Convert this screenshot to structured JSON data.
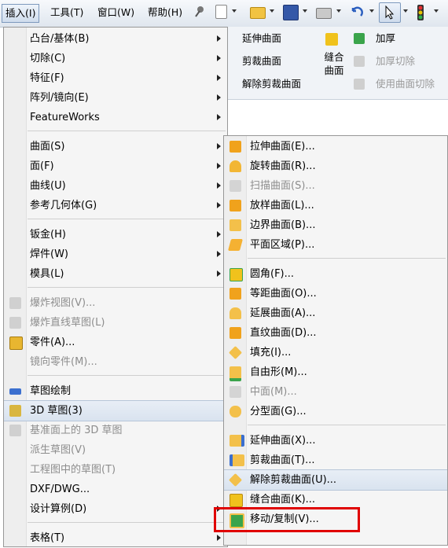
{
  "menubar": {
    "items": [
      "插入(I)",
      "工具(T)",
      "窗口(W)",
      "帮助(H)"
    ]
  },
  "ribbon": {
    "surface_items": [
      "延伸曲面",
      "剪裁曲面",
      "解除剪裁曲面"
    ],
    "knit": "缝合曲面",
    "thicken": [
      "加厚",
      "加厚切除",
      "使用曲面切除"
    ]
  },
  "insert_menu": {
    "items": [
      {
        "label": "凸台/基体(B)"
      },
      {
        "label": "切除(C)"
      },
      {
        "label": "特征(F)"
      },
      {
        "label": "阵列/镜向(E)"
      },
      {
        "label": "FeatureWorks"
      },
      {
        "label": "曲面(S)"
      },
      {
        "label": "面(F)"
      },
      {
        "label": "曲线(U)"
      },
      {
        "label": "参考几何体(G)"
      },
      {
        "label": "钣金(H)"
      },
      {
        "label": "焊件(W)"
      },
      {
        "label": "模具(L)"
      },
      {
        "label": "爆炸视图(V)..."
      },
      {
        "label": "爆炸直线草图(L)"
      },
      {
        "label": "零件(A)..."
      },
      {
        "label": "镜向零件(M)..."
      },
      {
        "label": "草图绘制"
      },
      {
        "label": "3D 草图(3)"
      },
      {
        "label": "基准面上的 3D 草图"
      },
      {
        "label": "派生草图(V)"
      },
      {
        "label": "工程图中的草图(T)"
      },
      {
        "label": "DXF/DWG..."
      },
      {
        "label": "设计算例(D)"
      },
      {
        "label": "表格(T)"
      }
    ]
  },
  "surface_submenu": {
    "items": [
      {
        "label": "拉伸曲面(E)...",
        "icon": "extruded-surface-icon"
      },
      {
        "label": "旋转曲面(R)...",
        "icon": "revolved-surface-icon"
      },
      {
        "label": "扫描曲面(S)...",
        "icon": "swept-surface-icon"
      },
      {
        "label": "放样曲面(L)...",
        "icon": "lofted-surface-icon"
      },
      {
        "label": "边界曲面(B)...",
        "icon": "boundary-surface-icon"
      },
      {
        "label": "平面区域(P)...",
        "icon": "planar-surface-icon"
      },
      {
        "label": "圆角(F)...",
        "icon": "fillet-icon"
      },
      {
        "label": "等距曲面(O)...",
        "icon": "offset-surface-icon"
      },
      {
        "label": "延展曲面(A)...",
        "icon": "radiate-surface-icon"
      },
      {
        "label": "直纹曲面(D)...",
        "icon": "ruled-surface-icon"
      },
      {
        "label": "填充(I)...",
        "icon": "fill-surface-icon"
      },
      {
        "label": "自由形(M)...",
        "icon": "freeform-icon"
      },
      {
        "label": "中面(M)...",
        "icon": "mid-surface-icon"
      },
      {
        "label": "分型面(G)...",
        "icon": "parting-surface-icon"
      },
      {
        "label": "延伸曲面(X)...",
        "icon": "extend-surface-icon"
      },
      {
        "label": "剪裁曲面(T)...",
        "icon": "trim-surface-icon"
      },
      {
        "label": "解除剪裁曲面(U)...",
        "icon": "untrim-surface-icon"
      },
      {
        "label": "缝合曲面(K)...",
        "icon": "knit-surface-icon"
      },
      {
        "label": "移动/复制(V)...",
        "icon": "move-copy-icon"
      }
    ]
  }
}
